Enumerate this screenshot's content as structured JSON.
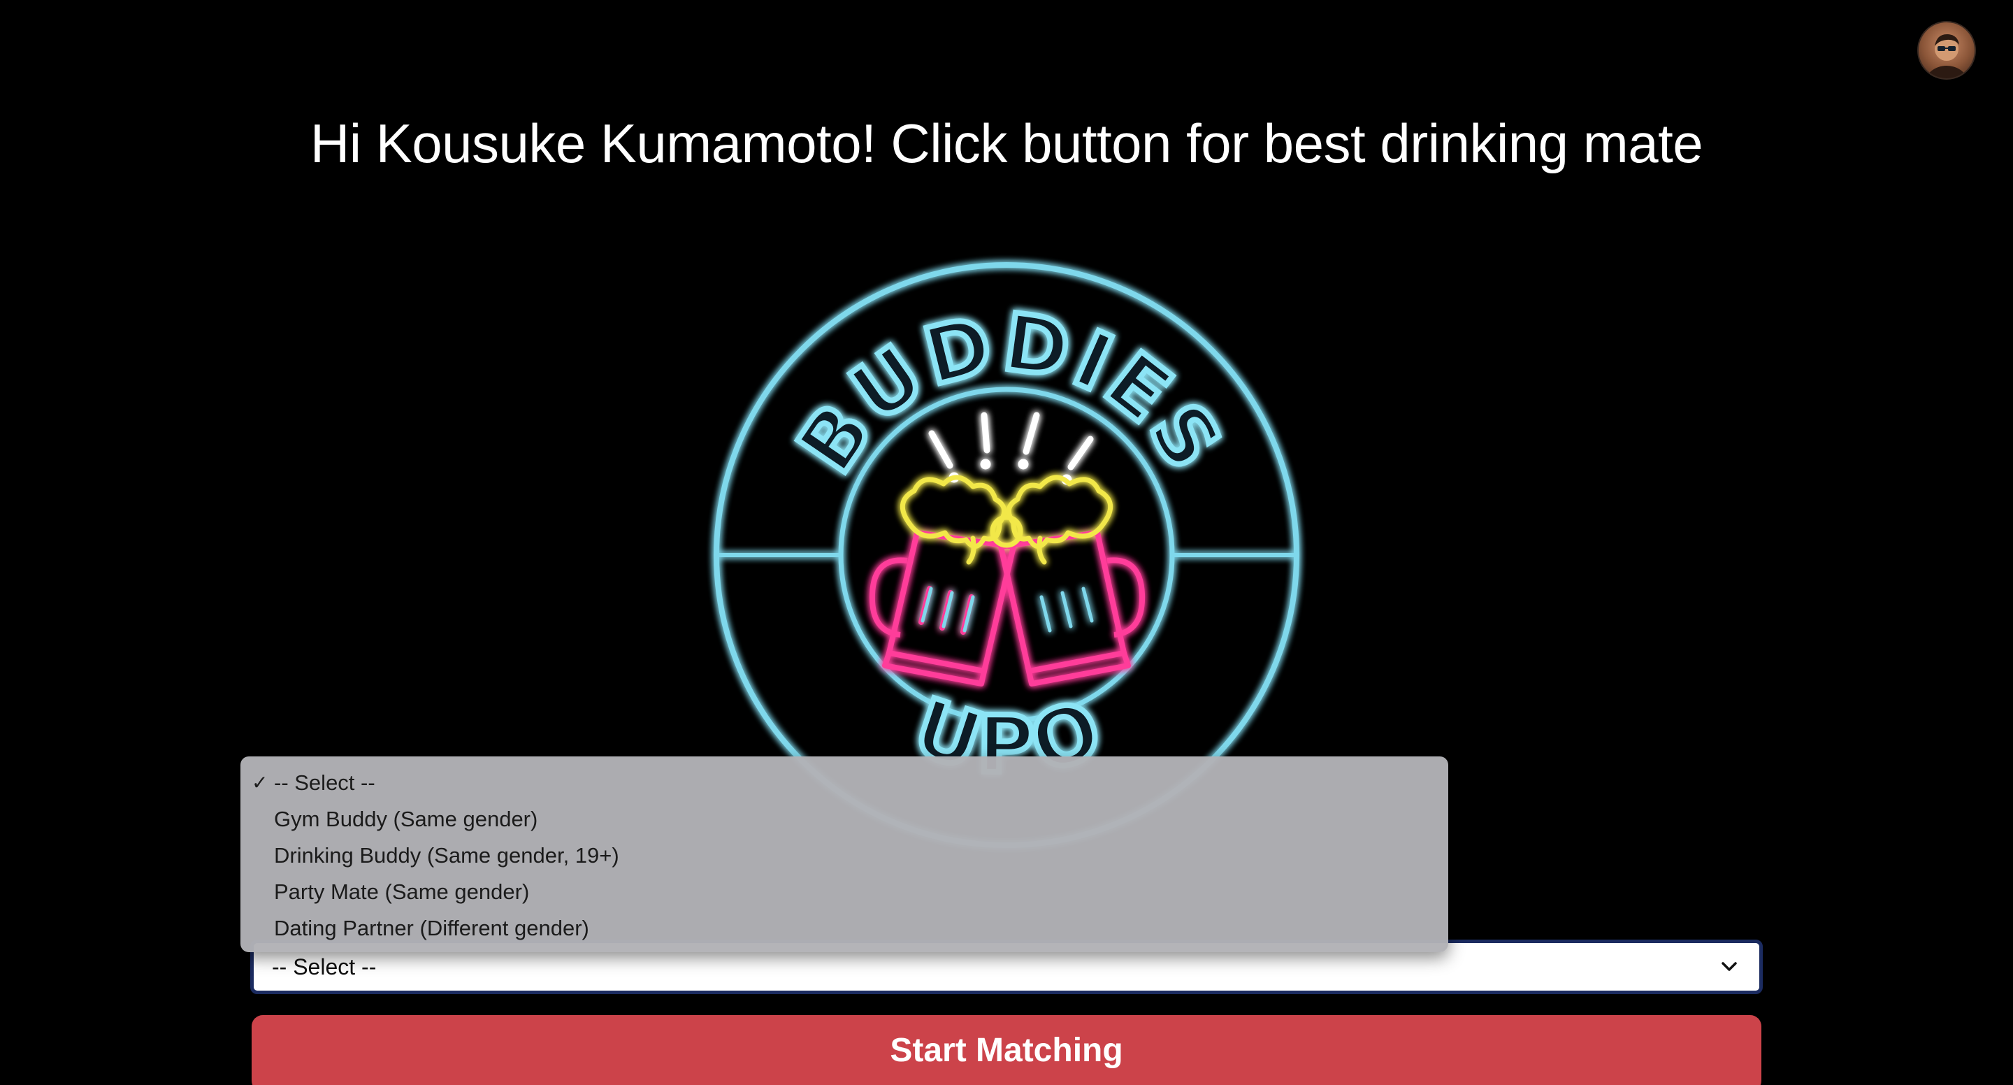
{
  "header": {
    "greeting": "Hi Kousuke Kumamoto! Click button for best drinking mate",
    "avatar_icon": "user-avatar"
  },
  "logo": {
    "top_text": "BUDDIES",
    "bottom_text": "UPO",
    "icon": "beer-mugs-cheers-icon",
    "colors": {
      "ring": "#7fd8ec",
      "foam": "#f2e84a",
      "mugs": "#ff3d9a",
      "spark": "#ffffff"
    }
  },
  "match_type": {
    "selected_label": "-- Select --",
    "options": [
      "-- Select --",
      "Gym Buddy (Same gender)",
      "Drinking Buddy (Same gender, 19+)",
      "Party Mate (Same gender)",
      "Dating Partner (Different gender)"
    ],
    "check_mark": "✓"
  },
  "actions": {
    "start_label": "Start Matching",
    "accent": "#cc434a"
  }
}
